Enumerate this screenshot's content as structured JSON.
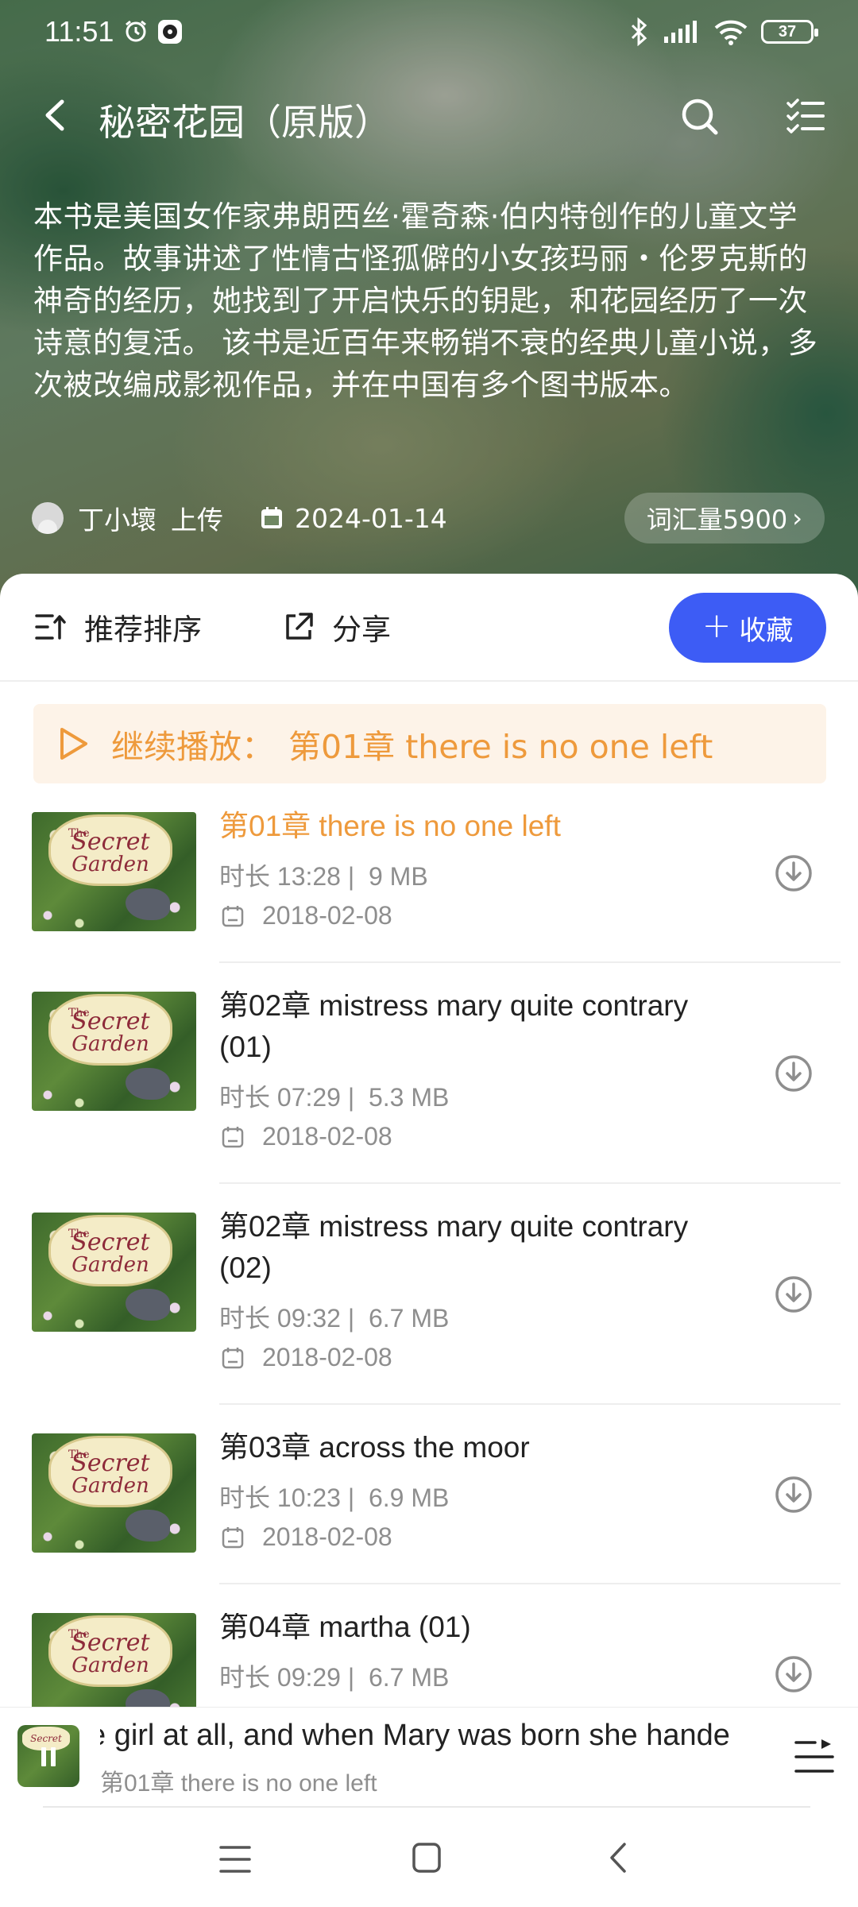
{
  "status_bar": {
    "time": "11:51",
    "battery": "37"
  },
  "header": {
    "title": "秘密花园（原版）"
  },
  "book": {
    "description": "本书是美国女作家弗朗西丝·霍奇森·伯内特创作的儿童文学作品。故事讲述了性情古怪孤僻的小女孩玛丽・伦罗克斯的神奇的经历，她找到了开启快乐的钥匙，和花园经历了一次诗意的复活。 该书是近百年来畅销不衰的经典儿童小说，多次被改编成影视作品，并在中国有多个图书版本。",
    "uploader": "丁小壞",
    "upload_label": "上传",
    "date": "2024-01-14",
    "vocab": "词汇量5900",
    "vocab_chevron": "›"
  },
  "toolbar": {
    "sort_label": "推荐排序",
    "share_label": "分享",
    "favorite_label": "收藏",
    "favorite_plus": "+"
  },
  "continue": {
    "label": "继续播放：",
    "chapter": "第01章 there is no one left"
  },
  "thumb_text": {
    "the": "The",
    "secret": "Secret",
    "garden": "Garden"
  },
  "episodes": [
    {
      "title": "第01章 there is no one left",
      "duration": "时长 13:28 |",
      "size": "9 MB",
      "date": "2018-02-08",
      "active": true
    },
    {
      "title": "第02章 mistress mary quite contrary (01)",
      "duration": "时长 07:29 |",
      "size": "5.3 MB",
      "date": "2018-02-08",
      "active": false
    },
    {
      "title": "第02章 mistress mary quite contrary (02)",
      "duration": "时长 09:32 |",
      "size": "6.7 MB",
      "date": "2018-02-08",
      "active": false
    },
    {
      "title": "第03章 across the moor",
      "duration": "时长 10:23 |",
      "size": "6.9 MB",
      "date": "2018-02-08",
      "active": false
    },
    {
      "title": "第04章 martha (01)",
      "duration": "时长 09:29 |",
      "size": "6.7 MB",
      "date": "",
      "active": false
    }
  ],
  "player": {
    "thumb_label": "Secret",
    "lyric": "e girl at all, and when Mary was born she hande",
    "subtitle": "第01章 there is no one left",
    "state": "playing"
  },
  "colors": {
    "accent_blue": "#3d5cf5",
    "accent_orange": "#ee9a3c",
    "continue_bg": "#fdf3e8"
  },
  "icons": [
    "back-icon",
    "search-icon",
    "playlist-icon",
    "sort-icon",
    "share-icon",
    "plus-icon",
    "play-icon",
    "download-icon",
    "calendar-icon",
    "pause-icon",
    "menu-icon",
    "home-icon",
    "nav-back-icon"
  ]
}
